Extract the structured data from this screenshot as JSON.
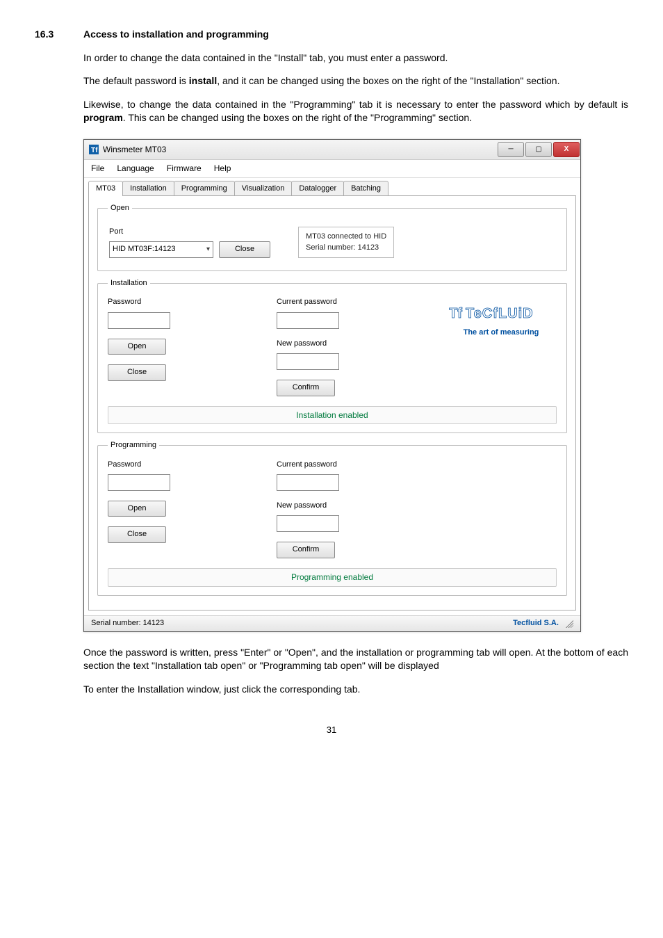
{
  "doc": {
    "section_num": "16.3",
    "section_title": "Access to installation and programming",
    "para1": "In order to change the data contained in the \"Install\" tab, you must enter a password.",
    "para2_a": "The default password is ",
    "para2_bold": "install",
    "para2_b": ", and it can be changed using the boxes on the right of the \"Installation\" section.",
    "para3_a": "Likewise, to change the data contained in the \"Programming\" tab it is necessary to enter the password which by default is ",
    "para3_bold": "program",
    "para3_b": ". This can be changed using the boxes on the right of the \"Programming\" section.",
    "para_after1": "Once the password is written, press \"Enter\" or \"Open\", and the installation or programming tab will open. At the bottom of each section the text \"Installation tab open\" or \"Programming tab open\" will be displayed",
    "para_after2": "To enter the Installation window, just click the corresponding tab.",
    "pagenum": "31"
  },
  "window": {
    "title": "Winsmeter MT03",
    "menus": [
      "File",
      "Language",
      "Firmware",
      "Help"
    ],
    "tabs": [
      "MT03",
      "Installation",
      "Programming",
      "Visualization",
      "Datalogger",
      "Batching"
    ],
    "open": {
      "legend": "Open",
      "port_label": "Port",
      "port_value": "HID  MT03F:14123",
      "close_btn": "Close",
      "status_line1": "MT03 connected to HID",
      "status_line2": "Serial number: 14123"
    },
    "installation": {
      "legend": "Installation",
      "password_label": "Password",
      "open_btn": "Open",
      "close_btn": "Close",
      "status": "Installation enabled",
      "current_pw": "Current password",
      "new_pw": "New password",
      "confirm_btn": "Confirm"
    },
    "programming": {
      "legend": "Programming",
      "password_label": "Password",
      "open_btn": "Open",
      "close_btn": "Close",
      "status": "Programming enabled",
      "current_pw": "Current password",
      "new_pw": "New password",
      "confirm_btn": "Confirm"
    },
    "brand": {
      "logo_text": "TeCfLUiD",
      "tagline": "The art of measuring"
    },
    "footer": {
      "left": "Serial number: 14123",
      "right": "Tecfluid S.A."
    }
  }
}
